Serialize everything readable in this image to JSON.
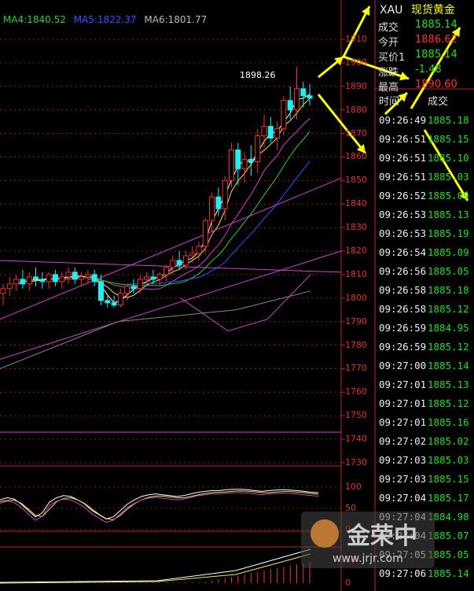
{
  "ma_legend": {
    "ma4": "MA4:1840.52",
    "ma5": "MA5:1822.37",
    "ma6": "MA6:1801.77",
    "colors": {
      "ma4": "#2ecc40",
      "ma5": "#3355ff",
      "ma6": "#bbbbbb"
    }
  },
  "chart_data": {
    "type": "candlestick",
    "ylim": [
      1725,
      1915
    ],
    "ytick_labels": [
      "1910",
      "1900",
      "1890",
      "1880",
      "1870",
      "1860",
      "1850",
      "1840",
      "1830",
      "1820",
      "1810",
      "1800",
      "1790",
      "1780",
      "1770",
      "1760",
      "1750",
      "1740",
      "1730"
    ],
    "peak_label": "1898.26",
    "candles": [
      {
        "o": 1802,
        "h": 1806,
        "l": 1797,
        "c": 1804
      },
      {
        "o": 1804,
        "h": 1809,
        "l": 1801,
        "c": 1806
      },
      {
        "o": 1806,
        "h": 1810,
        "l": 1803,
        "c": 1808
      },
      {
        "o": 1808,
        "h": 1812,
        "l": 1804,
        "c": 1806
      },
      {
        "o": 1806,
        "h": 1811,
        "l": 1803,
        "c": 1809
      },
      {
        "o": 1809,
        "h": 1813,
        "l": 1805,
        "c": 1808
      },
      {
        "o": 1808,
        "h": 1811,
        "l": 1804,
        "c": 1807
      },
      {
        "o": 1807,
        "h": 1811,
        "l": 1804,
        "c": 1810
      },
      {
        "o": 1810,
        "h": 1812,
        "l": 1805,
        "c": 1807
      },
      {
        "o": 1807,
        "h": 1811,
        "l": 1804,
        "c": 1809
      },
      {
        "o": 1809,
        "h": 1813,
        "l": 1806,
        "c": 1811
      },
      {
        "o": 1811,
        "h": 1813,
        "l": 1806,
        "c": 1808
      },
      {
        "o": 1808,
        "h": 1811,
        "l": 1805,
        "c": 1809
      },
      {
        "o": 1809,
        "h": 1812,
        "l": 1806,
        "c": 1810
      },
      {
        "o": 1810,
        "h": 1812,
        "l": 1805,
        "c": 1807
      },
      {
        "o": 1807,
        "h": 1810,
        "l": 1797,
        "c": 1799
      },
      {
        "o": 1799,
        "h": 1801,
        "l": 1796,
        "c": 1798
      },
      {
        "o": 1798,
        "h": 1801,
        "l": 1796,
        "c": 1797
      },
      {
        "o": 1797,
        "h": 1804,
        "l": 1796,
        "c": 1802
      },
      {
        "o": 1802,
        "h": 1806,
        "l": 1799,
        "c": 1805
      },
      {
        "o": 1805,
        "h": 1808,
        "l": 1802,
        "c": 1804
      },
      {
        "o": 1804,
        "h": 1810,
        "l": 1802,
        "c": 1808
      },
      {
        "o": 1808,
        "h": 1811,
        "l": 1805,
        "c": 1809
      },
      {
        "o": 1809,
        "h": 1812,
        "l": 1806,
        "c": 1808
      },
      {
        "o": 1808,
        "h": 1811,
        "l": 1805,
        "c": 1810
      },
      {
        "o": 1810,
        "h": 1814,
        "l": 1807,
        "c": 1813
      },
      {
        "o": 1813,
        "h": 1818,
        "l": 1810,
        "c": 1816
      },
      {
        "o": 1816,
        "h": 1820,
        "l": 1812,
        "c": 1814
      },
      {
        "o": 1814,
        "h": 1820,
        "l": 1812,
        "c": 1818
      },
      {
        "o": 1818,
        "h": 1822,
        "l": 1815,
        "c": 1819
      },
      {
        "o": 1819,
        "h": 1824,
        "l": 1816,
        "c": 1822
      },
      {
        "o": 1822,
        "h": 1834,
        "l": 1819,
        "c": 1833
      },
      {
        "o": 1833,
        "h": 1845,
        "l": 1828,
        "c": 1843
      },
      {
        "o": 1843,
        "h": 1847,
        "l": 1835,
        "c": 1838
      },
      {
        "o": 1838,
        "h": 1852,
        "l": 1833,
        "c": 1850
      },
      {
        "o": 1850,
        "h": 1866,
        "l": 1847,
        "c": 1863
      },
      {
        "o": 1863,
        "h": 1866,
        "l": 1848,
        "c": 1855
      },
      {
        "o": 1855,
        "h": 1862,
        "l": 1849,
        "c": 1859
      },
      {
        "o": 1859,
        "h": 1865,
        "l": 1852,
        "c": 1858
      },
      {
        "o": 1858,
        "h": 1872,
        "l": 1853,
        "c": 1869
      },
      {
        "o": 1869,
        "h": 1878,
        "l": 1864,
        "c": 1873
      },
      {
        "o": 1873,
        "h": 1877,
        "l": 1866,
        "c": 1868
      },
      {
        "o": 1868,
        "h": 1875,
        "l": 1863,
        "c": 1872
      },
      {
        "o": 1872,
        "h": 1886,
        "l": 1869,
        "c": 1884
      },
      {
        "o": 1884,
        "h": 1890,
        "l": 1876,
        "c": 1880
      },
      {
        "o": 1880,
        "h": 1898.26,
        "l": 1876,
        "c": 1889
      },
      {
        "o": 1889,
        "h": 1892,
        "l": 1881,
        "c": 1886
      },
      {
        "o": 1886,
        "h": 1891,
        "l": 1882,
        "c": 1885
      }
    ],
    "osc_tick_labels": [
      "100",
      "50",
      "0"
    ],
    "macd_tick_labels": [
      "50",
      "0"
    ]
  },
  "quote": {
    "symbol": "XAU",
    "name": "现货黄金",
    "rows": [
      {
        "label": "成交",
        "value": "1885.14",
        "color": "#2d2"
      },
      {
        "label": "今开",
        "value": "1886.62",
        "color": "#f33"
      },
      {
        "label": "买价1",
        "value": "1885.14",
        "color": "#2d2"
      },
      {
        "label": "涨跌",
        "value": "-1.48",
        "color": "#2d2"
      },
      {
        "label": "最高",
        "value": "1890.60",
        "color": "#f33"
      }
    ]
  },
  "ticks": {
    "header_time": "时间",
    "header_price": "成交",
    "rows": [
      {
        "time": "09:26:49",
        "price": "1885.18"
      },
      {
        "time": "09:26:51",
        "price": "1885.15"
      },
      {
        "time": "09:26:51",
        "price": "1885.10"
      },
      {
        "time": "09:26:51",
        "price": "1885.03"
      },
      {
        "time": "09:26:52",
        "price": "1885.09"
      },
      {
        "time": "09:26:53",
        "price": "1885.13"
      },
      {
        "time": "09:26:53",
        "price": "1885.19"
      },
      {
        "time": "09:26:54",
        "price": "1885.09"
      },
      {
        "time": "09:26:56",
        "price": "1885.05"
      },
      {
        "time": "09:26:58",
        "price": "1885.18"
      },
      {
        "time": "09:26:58",
        "price": "1885.12"
      },
      {
        "time": "09:26:59",
        "price": "1884.95"
      },
      {
        "time": "09:26:59",
        "price": "1885.12"
      },
      {
        "time": "09:27:00",
        "price": "1885.14"
      },
      {
        "time": "09:27:01",
        "price": "1885.13"
      },
      {
        "time": "09:27:01",
        "price": "1885.12"
      },
      {
        "time": "09:27:01",
        "price": "1885.16"
      },
      {
        "time": "09:27:02",
        "price": "1885.02"
      },
      {
        "time": "09:27:03",
        "price": "1885.03"
      },
      {
        "time": "09:27:03",
        "price": "1885.15"
      },
      {
        "time": "09:27:04",
        "price": "1885.17"
      },
      {
        "time": "09:27:04",
        "price": "1884.98"
      },
      {
        "time": "09:27:04",
        "price": "1885.07"
      },
      {
        "time": "09:27:05",
        "price": "1885.05"
      },
      {
        "time": "09:27:06",
        "price": "1885.14"
      }
    ]
  },
  "watermark": {
    "text": "金荣中",
    "url": "www.jrjr.com"
  }
}
